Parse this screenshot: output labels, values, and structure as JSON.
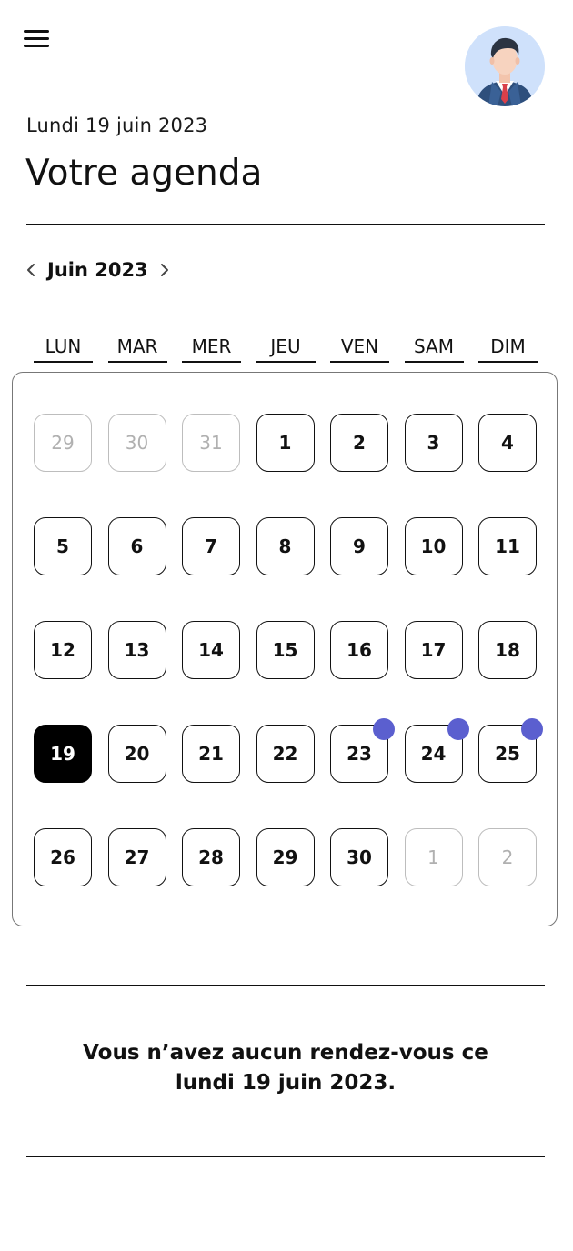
{
  "header": {
    "menu_icon": "hamburger-menu-icon",
    "avatar_icon": "user-avatar-icon",
    "date_subtitle": "Lundi 19 juin 2023",
    "title": "Votre agenda"
  },
  "calendar": {
    "prev_icon": "chevron-left-icon",
    "next_icon": "chevron-right-icon",
    "month_label": "Juin 2023",
    "weekdays": [
      "LUN",
      "MAR",
      "MER",
      "JEU",
      "VEN",
      "SAM",
      "DIM"
    ],
    "weeks": [
      [
        {
          "label": "29",
          "state": "muted"
        },
        {
          "label": "30",
          "state": "muted"
        },
        {
          "label": "31",
          "state": "muted"
        },
        {
          "label": "1",
          "state": "normal"
        },
        {
          "label": "2",
          "state": "normal"
        },
        {
          "label": "3",
          "state": "normal"
        },
        {
          "label": "4",
          "state": "normal"
        }
      ],
      [
        {
          "label": "5",
          "state": "normal"
        },
        {
          "label": "6",
          "state": "normal"
        },
        {
          "label": "7",
          "state": "normal"
        },
        {
          "label": "8",
          "state": "normal"
        },
        {
          "label": "9",
          "state": "normal"
        },
        {
          "label": "10",
          "state": "normal"
        },
        {
          "label": "11",
          "state": "normal"
        }
      ],
      [
        {
          "label": "12",
          "state": "normal"
        },
        {
          "label": "13",
          "state": "normal"
        },
        {
          "label": "14",
          "state": "normal"
        },
        {
          "label": "15",
          "state": "normal"
        },
        {
          "label": "16",
          "state": "normal"
        },
        {
          "label": "17",
          "state": "normal"
        },
        {
          "label": "18",
          "state": "normal"
        }
      ],
      [
        {
          "label": "19",
          "state": "selected"
        },
        {
          "label": "20",
          "state": "normal"
        },
        {
          "label": "21",
          "state": "normal"
        },
        {
          "label": "22",
          "state": "normal"
        },
        {
          "label": "23",
          "state": "normal",
          "has_event": true
        },
        {
          "label": "24",
          "state": "normal",
          "has_event": true
        },
        {
          "label": "25",
          "state": "normal",
          "has_event": true
        }
      ],
      [
        {
          "label": "26",
          "state": "normal"
        },
        {
          "label": "27",
          "state": "normal"
        },
        {
          "label": "28",
          "state": "normal"
        },
        {
          "label": "29",
          "state": "normal"
        },
        {
          "label": "30",
          "state": "normal"
        },
        {
          "label": "1",
          "state": "muted"
        },
        {
          "label": "2",
          "state": "muted"
        }
      ]
    ]
  },
  "appointments": {
    "empty_message_line1": "Vous n’avez aucun rendez-vous ce",
    "empty_message_line2": "lundi 19 juin 2023."
  },
  "colors": {
    "event_dot": "#5b5fcf",
    "selected_day_bg": "#000000",
    "avatar_bg": "#cfe1fb"
  }
}
